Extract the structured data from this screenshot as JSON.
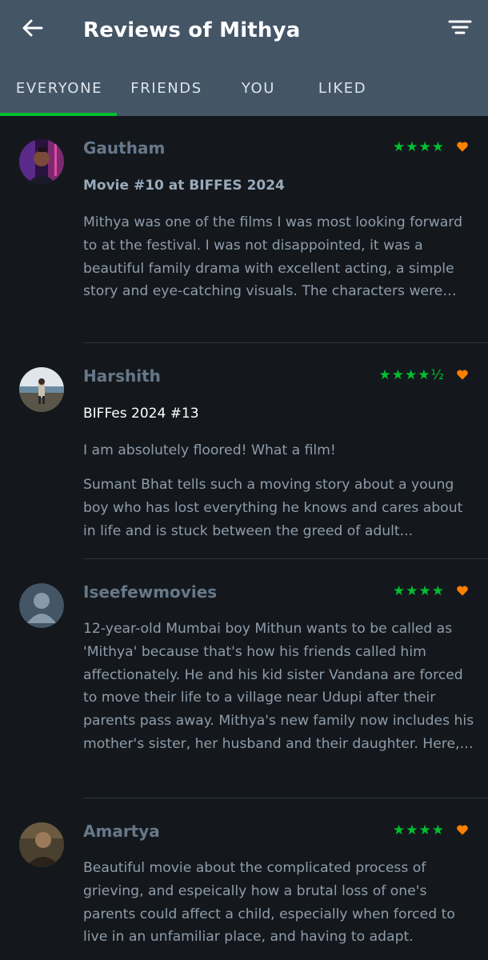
{
  "header": {
    "title": "Reviews of Mithya",
    "back_icon": "arrow-left-icon",
    "filter_icon": "filter-icon",
    "background": "#445566"
  },
  "tabs": [
    {
      "label": "EVERYONE",
      "active": true
    },
    {
      "label": "FRIENDS",
      "active": false
    },
    {
      "label": "YOU",
      "active": false
    },
    {
      "label": "LIKED",
      "active": false
    }
  ],
  "accent_color": "#00c030",
  "heart_color": "#ff8000",
  "reviews": [
    {
      "author": "Gautham",
      "rating": "★★★★",
      "liked": true,
      "title": "Movie #10 at BIFFES 2024",
      "body": "Mithya was one of the films I was most looking forward to at the festival. I was not disappointed, it was a beautiful family drama with excellent acting, a simple story and eye-catching visuals. The characters were able to truly transport us into their world, with ..."
    },
    {
      "author": "Harshith",
      "rating": "★★★★½",
      "liked": true,
      "title": "BIFFes 2024 #13",
      "subtitle": "I am absolutely floored! What a film!",
      "body": "Sumant Bhat tells such a moving story about a young boy who has lost everything he knows and cares about in life and is stuck between the greed of adult..."
    },
    {
      "author": "Iseefewmovies",
      "rating": "★★★★",
      "liked": true,
      "body": "12-year-old Mumbai boy Mithun wants to be called as 'Mithya' because that's how his friends called him affectionately. He and his kid sister Vandana are forced to move their life to a village near Udupi after their parents pass away. Mithya's new family now includes his mother's sister, her husband and their daughter. Here, we join Mithya in his character build..."
    },
    {
      "author": "Amartya",
      "rating": "★★★★",
      "liked": true,
      "body": "Beautiful movie about the complicated process of grieving, and espeically how a brutal loss of one's parents could affect a child, especially when forced to live in an unfamiliar place, and having to adapt."
    }
  ]
}
